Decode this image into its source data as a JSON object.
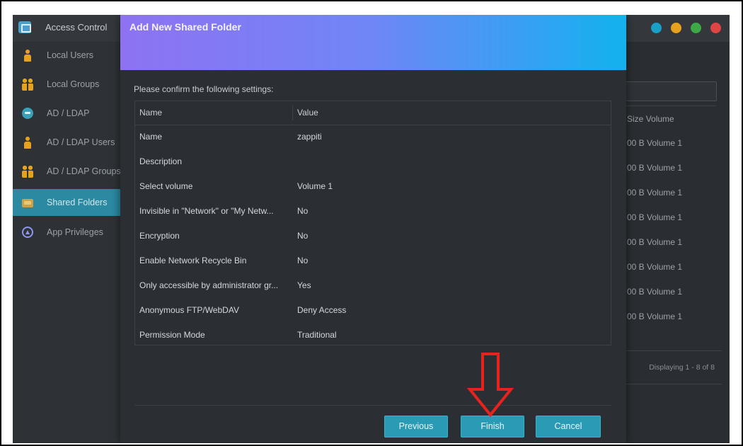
{
  "app": {
    "title": "Access Control",
    "window_dots": [
      "#1a9fc7",
      "#e6a21f",
      "#3daa47",
      "#e04545"
    ]
  },
  "sidebar": {
    "items": [
      {
        "label": "Local Users",
        "icon": "user-icon",
        "active": false
      },
      {
        "label": "Local Groups",
        "icon": "group-icon",
        "active": false
      },
      {
        "label": "AD / LDAP",
        "icon": "ad-ldap-icon",
        "active": false
      },
      {
        "label": "AD / LDAP Users",
        "icon": "user-icon",
        "active": false
      },
      {
        "label": "AD / LDAP Groups",
        "icon": "group-icon",
        "active": false
      },
      {
        "label": "Shared Folders",
        "icon": "folder-icon",
        "active": true
      },
      {
        "label": "App Privileges",
        "icon": "app-privileges-icon",
        "active": false
      }
    ]
  },
  "background_table": {
    "headers": {
      "size": "Size",
      "volume": "Volume"
    },
    "rows": [
      "00 B  Volume 1",
      "00 B  Volume 1",
      "00 B  Volume 1",
      "00 B  Volume 1",
      "00 B  Volume 1",
      "00 B  Volume 1",
      "00 B  Volume 1",
      "00 B  Volume 1"
    ],
    "display_text": "Displaying 1 - 8 of 8"
  },
  "dialog": {
    "title": "Add New Shared Folder",
    "confirm_text": "Please confirm the following settings:",
    "columns": {
      "name": "Name",
      "value": "Value"
    },
    "rows": [
      {
        "name": "Name",
        "value": "zappiti"
      },
      {
        "name": "Description",
        "value": ""
      },
      {
        "name": "Select volume",
        "value": "Volume 1"
      },
      {
        "name": "Invisible in \"Network\" or \"My Netw...",
        "value": "No"
      },
      {
        "name": "Encryption",
        "value": "No"
      },
      {
        "name": "Enable Network Recycle Bin",
        "value": "No"
      },
      {
        "name": "Only accessible by administrator gr...",
        "value": "Yes"
      },
      {
        "name": "Anonymous FTP/WebDAV",
        "value": "Deny Access"
      },
      {
        "name": "Permission Mode",
        "value": "Traditional"
      }
    ],
    "buttons": {
      "previous": "Previous",
      "finish": "Finish",
      "cancel": "Cancel"
    }
  },
  "colors": {
    "accent": "#2a9bb5",
    "header_gradient": [
      "#8e72f2",
      "#12b2ee"
    ],
    "annotation": "#e8231d"
  }
}
